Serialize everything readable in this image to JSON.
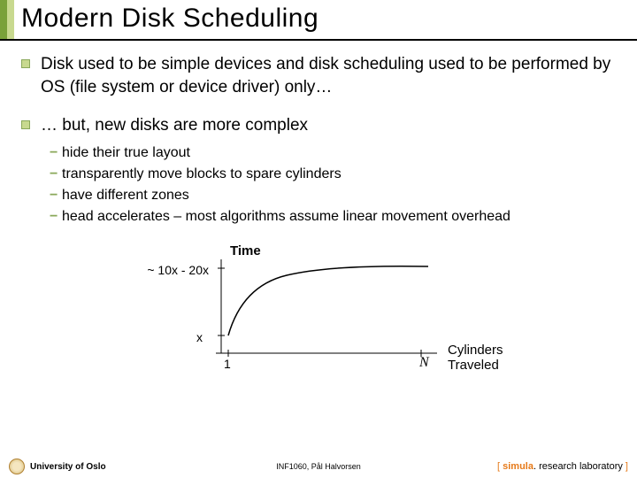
{
  "title": "Modern Disk Scheduling",
  "bullets": [
    {
      "text": "Disk used to be simple devices and disk scheduling used to be performed by OS (file system or device driver) only…",
      "subs": []
    },
    {
      "text": "… but, new disks are more complex",
      "subs": [
        "hide their true layout",
        "transparently move blocks to spare cylinders",
        "have different zones",
        "head accelerates – most algorithms assume linear movement overhead"
      ]
    }
  ],
  "chart_data": {
    "type": "line",
    "title": "Time",
    "xlabel": "Cylinders Traveled",
    "ylabel": "",
    "x_ticks": [
      "1",
      "N"
    ],
    "y_ticks": [
      "x",
      "~ 10x - 20x"
    ],
    "x": [
      1,
      5,
      15,
      35,
      70,
      120,
      180,
      230
    ],
    "y": [
      1,
      6,
      10,
      13.5,
      16,
      17.5,
      18.3,
      18.7
    ],
    "ylim": [
      0,
      20
    ],
    "note": "sublinear (sqrt-like) seek time curve"
  },
  "footer": {
    "left": "University of Oslo",
    "center": "INF1060, Pål Halvorsen",
    "right_prefix": "[ ",
    "right_brand1": "simula",
    "right_brand2": ". research laboratory",
    "right_suffix": " ]"
  }
}
